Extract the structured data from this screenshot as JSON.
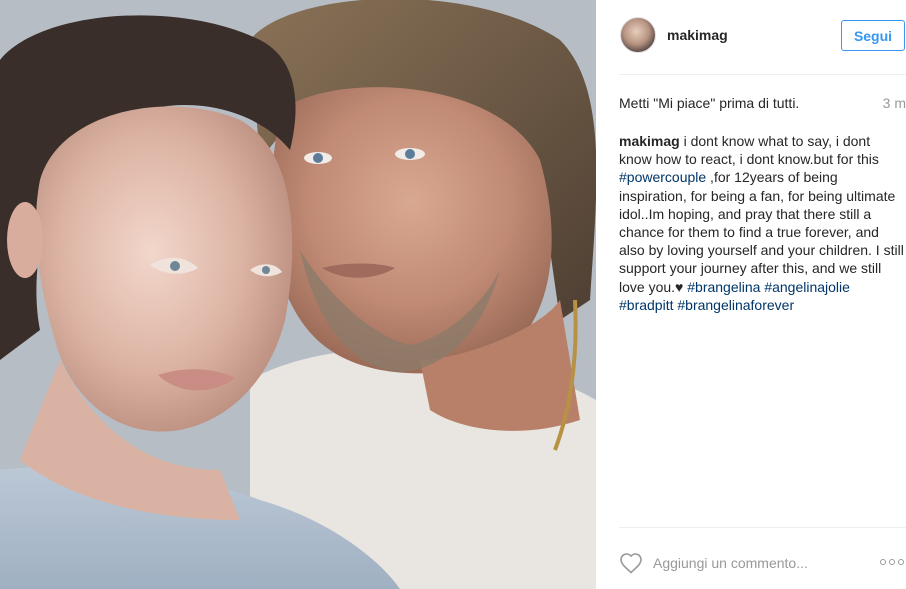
{
  "post": {
    "image_alt": "couple portrait",
    "username": "makimag",
    "follow_label": "Segui",
    "likes_text": "Metti \"Mi piace\" prima di tutti.",
    "time": "3 m",
    "caption": {
      "user": "makimag",
      "text_1": " i dont know what to say, i dont know how to react, i dont know.but for this ",
      "tag_1": "#powercouple",
      "text_2": " ,for 12years of being inspiration, for being a fan, for being ultimate idol..Im hoping, and pray that there still a chance for them to find a true forever, and also by loving yourself and your children. I still support your journey after this, and we still love you.♥ ",
      "tag_2": "#brangelina",
      "tag_3": "#angelinajolie",
      "tag_4": "#bradpitt",
      "tag_5": "#brangelinaforever"
    },
    "comment_placeholder": "Aggiungi un commento..."
  },
  "icons": {
    "heart": "heart-icon",
    "more": "more-options-icon"
  },
  "colors": {
    "accent": "#3897f0",
    "hashtag": "#003569",
    "muted": "#999999",
    "divider": "#efefef"
  }
}
